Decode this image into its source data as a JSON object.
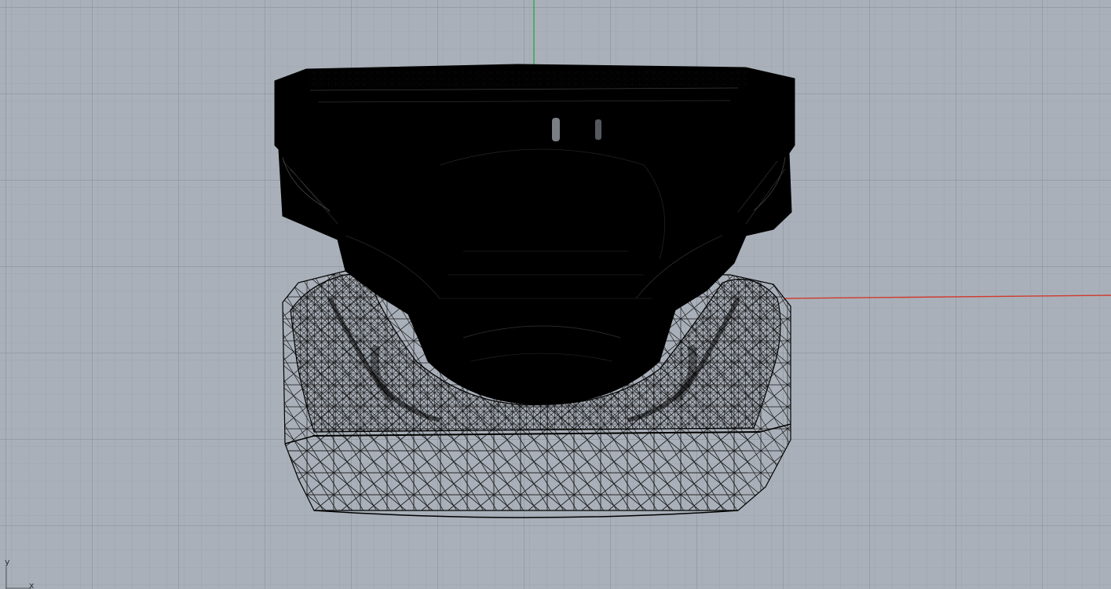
{
  "viewport": {
    "view_name": "",
    "background_color": "#a9b0b9",
    "grid": {
      "visible": true,
      "minor_color": "#9ca3ac",
      "major_color": "#8a919a"
    },
    "axes": {
      "x_axis_color": "#d03a2e",
      "y_axis_color": "#2fa84a"
    },
    "gumball": {
      "y_label": "y",
      "x_label": "x"
    },
    "model": {
      "display_mode": "wireframe-mesh",
      "mesh_color": "#000000",
      "description_icon": "dental-model-mesh-icon"
    }
  }
}
